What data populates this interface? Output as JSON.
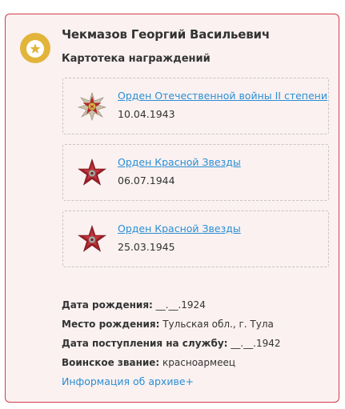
{
  "person": {
    "name": "Чекмазов Георгий Васильевич",
    "section_title": "Картотека награждений"
  },
  "awards": [
    {
      "title": "Орден Отечественной войны II степени",
      "date": "10.04.1943",
      "icon": "order-patriotic-war-icon"
    },
    {
      "title": "Орден Красной Звезды",
      "date": "06.07.1944",
      "icon": "order-red-star-icon"
    },
    {
      "title": "Орден Красной Звезды",
      "date": "25.03.1945",
      "icon": "order-red-star-icon"
    }
  ],
  "details": {
    "birth_date_label": "Дата рождения:",
    "birth_date_value": "__.__.1924",
    "birth_place_label": "Место рождения:",
    "birth_place_value": "Тульская обл., г. Тула",
    "service_date_label": "Дата поступления на службу:",
    "service_date_value": "__.__.1942",
    "rank_label": "Воинское звание:",
    "rank_value": "красноармеец"
  },
  "archive_link": "Информация об архиве+",
  "colors": {
    "card_border": "#d13b4a",
    "card_background": "#fbf1f1",
    "link": "#2a8fd4",
    "badge": "#e2b43a"
  }
}
